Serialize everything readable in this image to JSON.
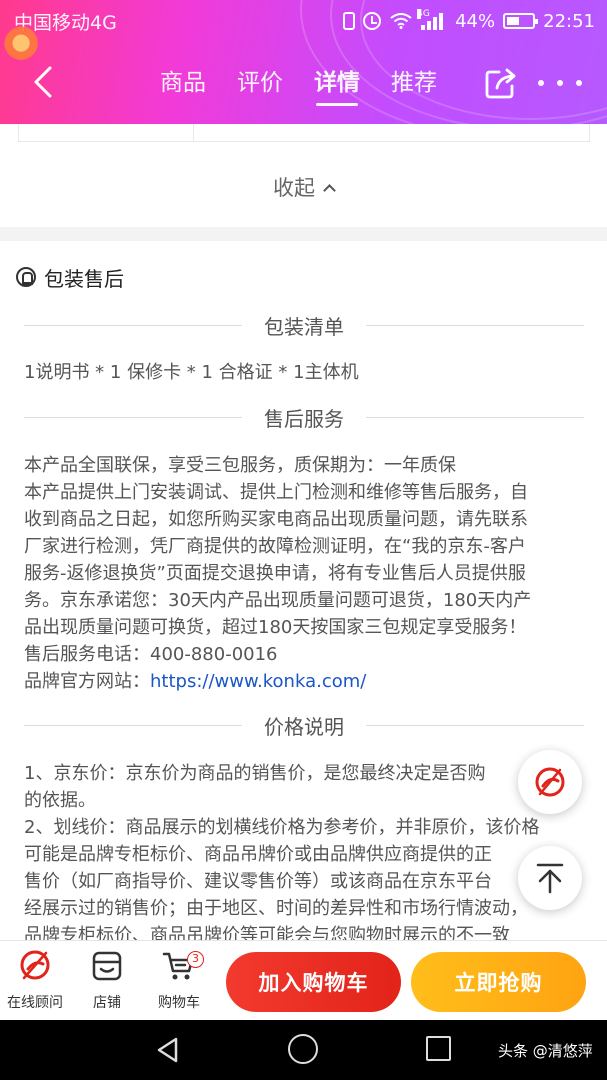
{
  "status_bar": {
    "carrier": "中国移动4G",
    "network": "4G",
    "battery": "44%",
    "time": "22:51"
  },
  "nav": {
    "tabs": [
      {
        "label": "商品",
        "active": false
      },
      {
        "label": "评价",
        "active": false
      },
      {
        "label": "详情",
        "active": true
      },
      {
        "label": "推荐",
        "active": false
      }
    ],
    "back_icon": "chevron-left-icon",
    "share_icon": "share-icon",
    "more_icon": "more-dots-icon"
  },
  "collapse_label": "收起",
  "section": {
    "title": "包装售后",
    "packing_list": {
      "heading": "包装清单",
      "text": "1说明书 * 1 保修卡 * 1 合格证 * 1主体机"
    },
    "after_sales": {
      "heading": "售后服务",
      "lines": [
        "本产品全国联保，享受三包服务，质保期为：一年质保",
        "本产品提供上门安装调试、提供上门检测和维修等售后服务，自",
        "收到商品之日起，如您所购买家电商品出现质量问题，请先联系",
        "厂家进行检测，凭厂商提供的故障检测证明，在“我的京东-客户",
        "服务-返修退换货”页面提交退换申请，将有专业售后人员提供服",
        "务。京东承诺您：30天内产品出现质量问题可退货，180天内产",
        "品出现质量问题可换货，超过180天按国家三包规定享受服务！"
      ],
      "phone_line": "售后服务电话：400-880-0016",
      "website_label": "品牌官方网站：",
      "website_url": "https://www.konka.com/"
    },
    "price_note": {
      "heading": "价格说明",
      "lines": [
        "1、京东价：京东价为商品的销售价，是您最终决定是否购",
        "的依据。",
        "2、划线价：商品展示的划横线价格为参考价，并非原价，该价格",
        "可能是品牌专柜标价、商品吊牌价或由品牌供应商提供的正",
        "售价（如厂商指导价、建议零售价等）或该商品在京东平台",
        "经展示过的销售价；由于地区、时间的差异性和市场行情波动，",
        "品牌专柜标价、商品吊牌价等可能会与您购物时展示的不一致"
      ]
    }
  },
  "floating": {
    "consult_icon": "customer-service-icon",
    "top_icon": "arrow-up-icon"
  },
  "bottom_bar": {
    "consult_label": "在线顾问",
    "shop_label": "店铺",
    "cart_label": "购物车",
    "cart_count": "3",
    "add_to_cart_label": "加入购物车",
    "buy_now_label": "立即抢购",
    "brand_color": "#e2231a",
    "buy_color": "#ffa312"
  },
  "watermark": "头条 @清悠萍"
}
